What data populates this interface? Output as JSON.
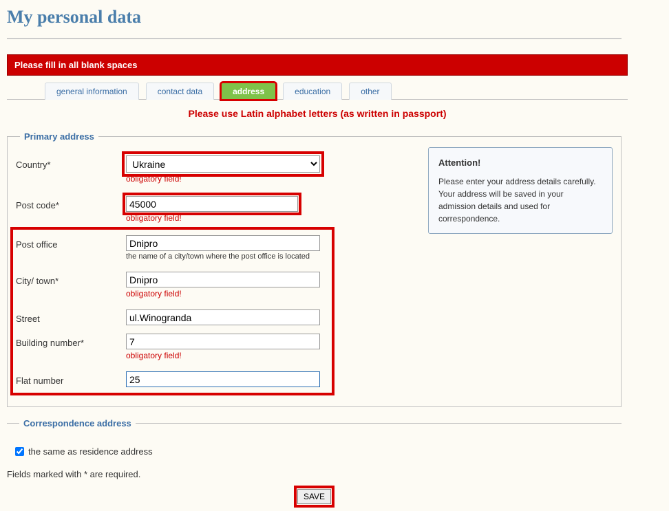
{
  "page_title": "My personal data",
  "error_banner": "Please fill in all blank spaces",
  "tabs": {
    "general": "general information",
    "contact": "contact data",
    "address": "address",
    "education": "education",
    "other": "other"
  },
  "latin_note": "Please use Latin alphabet letters (as written in passport)",
  "primary_legend": "Primary address",
  "labels": {
    "country": "Country*",
    "post_code": "Post code*",
    "post_office": "Post office",
    "city_town": "City/ town*",
    "street": "Street",
    "building_number": "Building number*",
    "flat_number": "Flat number"
  },
  "values": {
    "country": "Ukraine",
    "post_code": "45000",
    "post_office": "Dnipro",
    "city_town": "Dnipro",
    "street": "ul.Winogranda",
    "building_number": "7",
    "flat_number": "25"
  },
  "hints": {
    "post_office": "the name of a city/town where the post office is located"
  },
  "obligatory_text": "obligatory field!",
  "attention": {
    "title": "Attention!",
    "text": "Please enter your address details carefully. Your address will be saved in your admission details and used for correspondence."
  },
  "correspondence_legend": "Correspondence address",
  "same_as_label": "the same as residence address",
  "same_as_checked": true,
  "required_note": "Fields marked with * are required.",
  "save_label": "SAVE"
}
